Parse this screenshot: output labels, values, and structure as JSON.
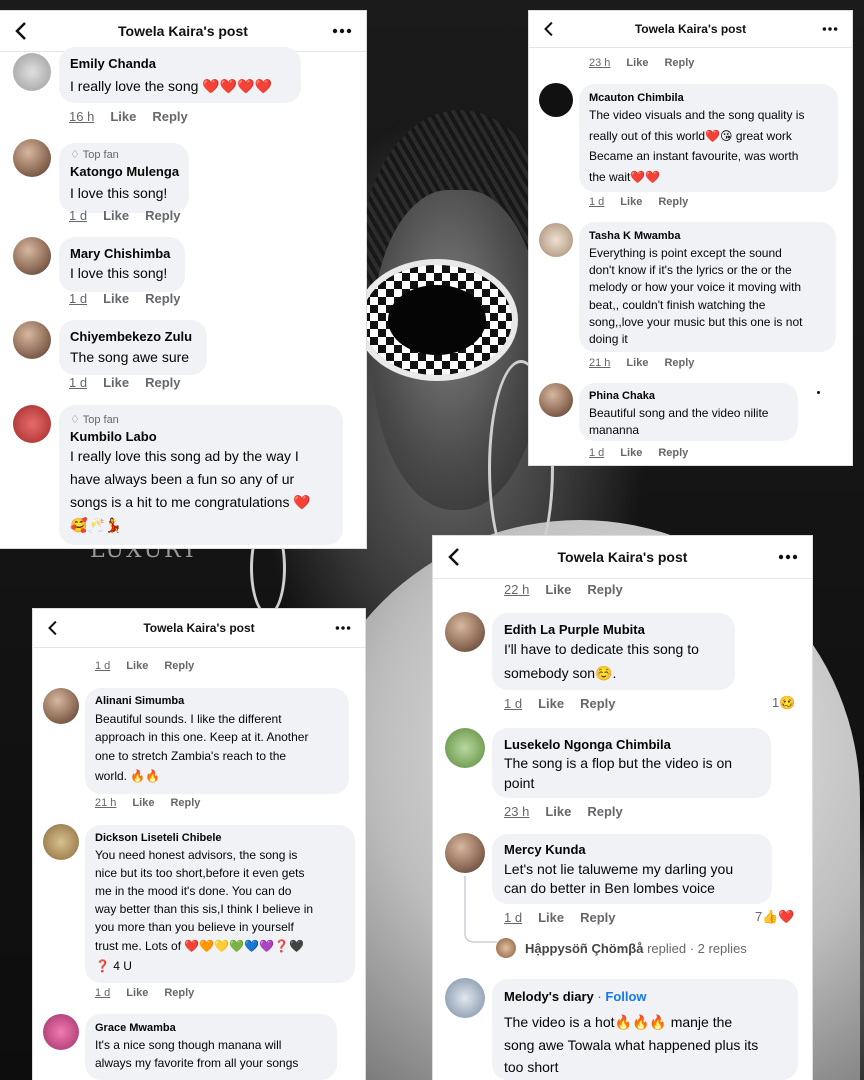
{
  "cards": [
    {
      "title": "Towela Kaira's post",
      "comments": [
        {
          "name": "Emily Chanda",
          "text": "I really love the song ❤️❤️❤️❤️",
          "time": "16 h",
          "like": "Like",
          "reply": "Reply"
        },
        {
          "badge": "Top fan",
          "name": "Katongo Mulenga",
          "text": "I love this song!",
          "time": "1 d",
          "like": "Like",
          "reply": "Reply"
        },
        {
          "name": "Mary Chishimba",
          "text": "I love this song!",
          "time": "1 d",
          "like": "Like",
          "reply": "Reply"
        },
        {
          "name": "Chiyembekezo Zulu",
          "text": "The song awe sure",
          "time": "1 d",
          "like": "Like",
          "reply": "Reply"
        },
        {
          "badge": "Top fan",
          "name": "Kumbilo Labo",
          "lines": [
            "I really love this song ad by the way  I",
            "have always been a fun so any of ur",
            "songs is a hit to me congratulations ❤️",
            "🥰🥂💃"
          ]
        }
      ]
    },
    {
      "title": "Towela Kaira's post",
      "top_actions": {
        "time": "23 h",
        "like": "Like",
        "reply": "Reply"
      },
      "comments": [
        {
          "name": "Mcauton Chimbila",
          "lines": [
            "The video visuals and the song quality is",
            "really out of this world❤️😘 great work",
            "Became an instant favourite, was worth",
            "the wait❤️❤️"
          ],
          "time": "1 d",
          "like": "Like",
          "reply": "Reply"
        },
        {
          "name": "Tasha K Mwamba",
          "lines": [
            "Everything is point except the sound",
            "don't know if it's the lyrics or the or the",
            "melody or how your voice it moving with",
            "beat,, couldn't finish watching the",
            "song,,love your music but this one is not",
            "doing it"
          ],
          "time": "21 h",
          "like": "Like",
          "reply": "Reply"
        },
        {
          "name": "Phina Chaka",
          "lines": [
            "Beautiful song and the video nilite",
            "mananna"
          ],
          "time": "1 d",
          "like": "Like",
          "reply": "Reply"
        }
      ]
    },
    {
      "title": "Towela Kaira's post",
      "top_actions": {
        "time": "1 d",
        "like": "Like",
        "reply": "Reply"
      },
      "comments": [
        {
          "name": "Alinani Simumba",
          "lines": [
            "Beautiful sounds. I like the different",
            "approach in this one. Keep at it. Another",
            "one to stretch Zambia's reach to the",
            "world. 🔥🔥"
          ],
          "time": "21 h",
          "like": "Like",
          "reply": "Reply"
        },
        {
          "name": "Dickson Liseteli Chibele",
          "lines": [
            "You need honest advisors, the song is",
            "nice but its too short,before it even gets",
            "me in the mood it's done. You can do",
            "way better than this sis,I think I believe in",
            "you more than you believe in yourself",
            "trust me. Lots of ❤️🧡💛💚💙💜❓🖤",
            "❓ 4 U"
          ],
          "time": "1 d",
          "like": "Like",
          "reply": "Reply"
        },
        {
          "name": "Grace Mwamba",
          "lines": [
            "It's a nice song though manana will",
            "always my favorite from all your songs"
          ]
        }
      ]
    },
    {
      "title": "Towela Kaira's post",
      "top_actions": {
        "time": "22 h",
        "like": "Like",
        "reply": "Reply"
      },
      "comments": [
        {
          "name": "Edith La Purple Mubita",
          "lines": [
            "I'll have to dedicate this song to",
            "somebody son☺️."
          ],
          "time": "1 d",
          "like": "Like",
          "reply": "Reply",
          "reactions": "1🥴"
        },
        {
          "name": "Lusekelo Ngonga Chimbila",
          "lines": [
            "The song is a flop but the video is on",
            "point"
          ],
          "time": "23 h",
          "like": "Like",
          "reply": "Reply"
        },
        {
          "name": "Mercy Kunda",
          "lines": [
            "Let's not lie taluweme my darling you",
            "can do better in Ben lombes voice"
          ],
          "time": "1 d",
          "like": "Like",
          "reply": "Reply",
          "reactions": "7👍❤️",
          "replied_by": "Hậppysöñ Çhömβå",
          "replied_suffix": "replied · 2 replies"
        },
        {
          "name": "Melody's diary",
          "follow": "Follow",
          "lines": [
            "The video is a hot🔥🔥🔥 manje the",
            "song awe Towala what happened plus its",
            "too short"
          ]
        }
      ]
    }
  ],
  "watermark": "LUXURY",
  "colors": {
    "link": "#1877f2",
    "bubble": "#f0f2f5",
    "meta": "#65676b"
  }
}
